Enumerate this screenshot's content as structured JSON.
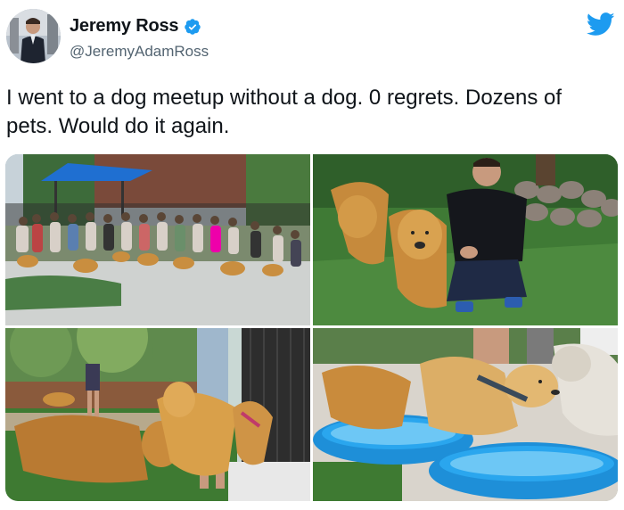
{
  "author": {
    "display_name": "Jeremy Ross",
    "handle": "@JeremyAdamRoss",
    "verified": true,
    "avatar_icon": "profile-photo"
  },
  "tweet": {
    "text": "I went to a dog meetup without a dog. 0 regrets. Dozens of pets. Would do it again."
  },
  "media": [
    {
      "icon": "photo-group-of-people-and-golden-retrievers"
    },
    {
      "icon": "photo-man-crouching-with-golden-retrievers"
    },
    {
      "icon": "photo-golden-retrievers-on-grass"
    },
    {
      "icon": "photo-golden-retrievers-at-kiddie-pools"
    }
  ],
  "colors": {
    "brand_blue": "#1d9bf0",
    "text": "#0f1419",
    "secondary_text": "#536471"
  }
}
